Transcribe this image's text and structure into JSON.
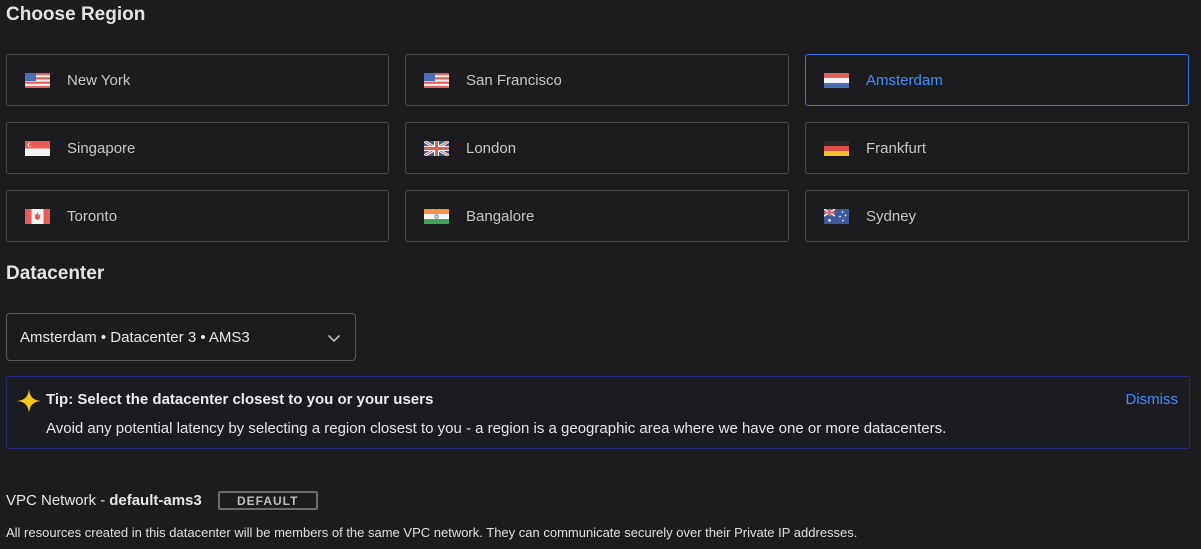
{
  "region_section": {
    "title": "Choose Region",
    "regions": [
      {
        "label": "New York",
        "flag": "us-flag-icon"
      },
      {
        "label": "San Francisco",
        "flag": "us-flag-icon"
      },
      {
        "label": "Amsterdam",
        "flag": "netherlands-flag-icon",
        "selected": true
      },
      {
        "label": "Singapore",
        "flag": "singapore-flag-icon"
      },
      {
        "label": "London",
        "flag": "uk-flag-icon"
      },
      {
        "label": "Frankfurt",
        "flag": "germany-flag-icon"
      },
      {
        "label": "Toronto",
        "flag": "canada-flag-icon"
      },
      {
        "label": "Bangalore",
        "flag": "india-flag-icon"
      },
      {
        "label": "Sydney",
        "flag": "australia-flag-icon"
      }
    ]
  },
  "datacenter_section": {
    "title": "Datacenter",
    "selected_value": "Amsterdam • Datacenter 3 • AMS3"
  },
  "tip": {
    "title": "Tip: Select the datacenter closest to you or your users",
    "body": "Avoid any potential latency by selecting a region closest to you - a region is a geographic area where we have one or more datacenters.",
    "dismiss_label": "Dismiss"
  },
  "vpc": {
    "label": "VPC Network -",
    "name": "default-ams3",
    "badge": "DEFAULT",
    "description": "All resources created in this datacenter will be members of the same VPC network. They can communicate securely over their Private IP addresses."
  },
  "colors": {
    "background": "#1c1c1e",
    "card_border": "#4a4a4e",
    "accent": "#3d8cff",
    "selected_border": "#2f6fdf",
    "tip_border": "#232a7a",
    "tip_star": "#f5c518"
  }
}
